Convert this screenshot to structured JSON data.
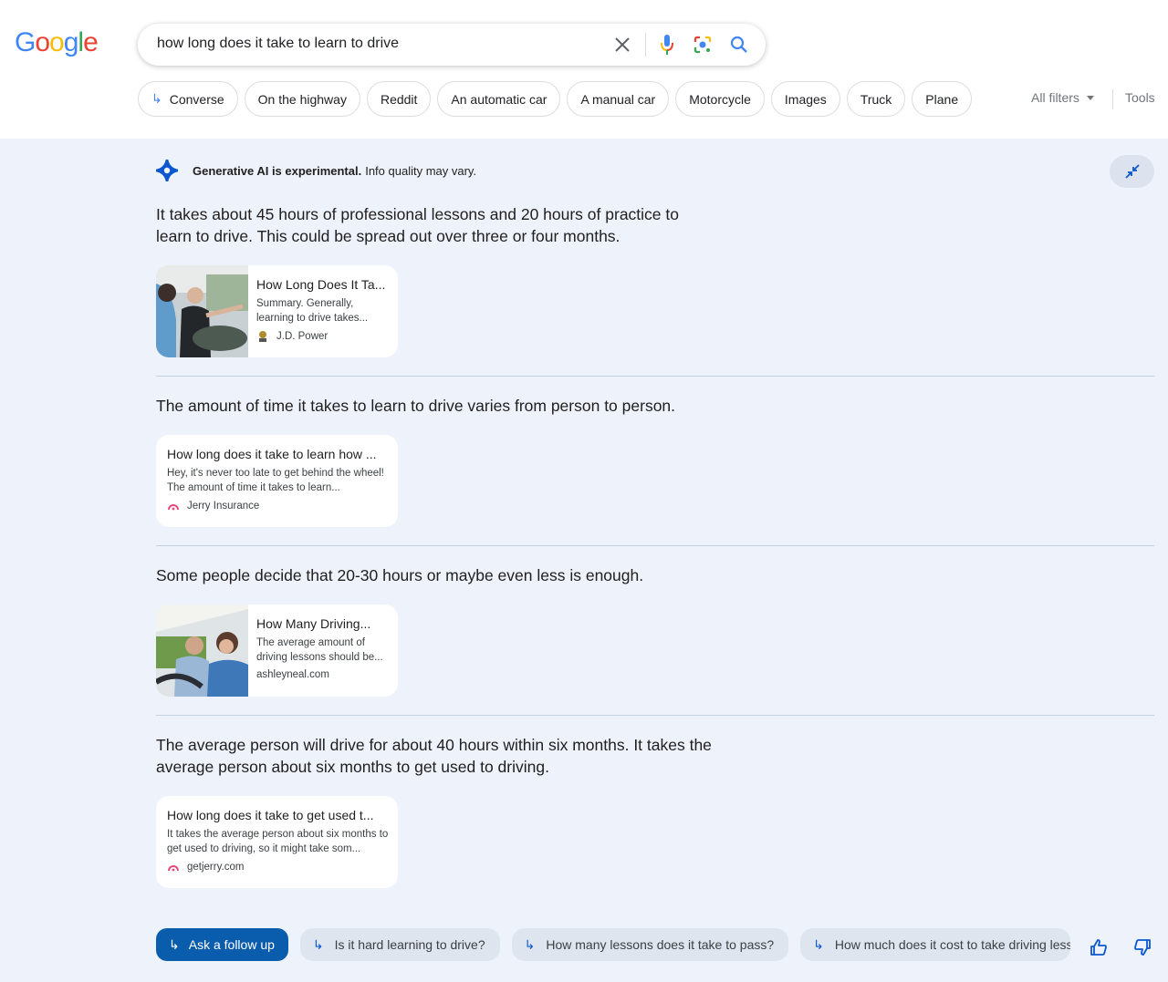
{
  "header": {
    "logo": {
      "letters": [
        "G",
        "o",
        "o",
        "g",
        "l",
        "e"
      ],
      "colors": [
        "#4285f4",
        "#ea4335",
        "#fbbc05",
        "#4285f4",
        "#34a853",
        "#ea4335"
      ]
    },
    "search": {
      "query": "how long does it take to learn to drive"
    },
    "icons": {
      "clear": "close-icon",
      "voice": "microphone-icon",
      "lens": "lens-icon",
      "search": "search-icon"
    },
    "chips": [
      {
        "label": "Converse",
        "icon": "follow-up-arrow-icon"
      },
      {
        "label": "On the highway"
      },
      {
        "label": "Reddit"
      },
      {
        "label": "An automatic car"
      },
      {
        "label": "A manual car"
      },
      {
        "label": "Motorcycle"
      },
      {
        "label": "Images"
      },
      {
        "label": "Truck"
      },
      {
        "label": "Plane"
      }
    ],
    "all_filters": "All filters",
    "tools": "Tools"
  },
  "sge": {
    "banner_bold": "Generative AI is experimental.",
    "banner_rest": "Info quality may vary.",
    "accent": "#0b57d0",
    "sections": [
      {
        "text": "It takes about 45 hours of professional lessons and 20 hours of practice to learn to drive. This could be spread out over three or four months.",
        "card": {
          "title": "How Long Does It Ta...",
          "snippet": "Summary. Generally, learning to drive takes...",
          "source": "J.D. Power",
          "has_image": true
        }
      },
      {
        "text": "The amount of time it takes to learn to drive varies from person to person.",
        "card": {
          "title": "How long does it take to learn how ...",
          "snippet": "Hey, it's never too late to get behind the wheel! The amount of time it takes to learn...",
          "source": "Jerry Insurance",
          "has_image": false
        }
      },
      {
        "text": "Some people decide that 20-30 hours or maybe even less is enough.",
        "card": {
          "title": "How Many Driving...",
          "snippet": "The average amount of driving lessons should be...",
          "source": "ashleyneal.com",
          "has_image": true
        }
      },
      {
        "text": "The average person will drive for about 40 hours within six months. It takes the average person about six months to get used to driving.",
        "card": {
          "title": "How long does it take to get used t...",
          "snippet": "It takes the average person about six months to get used to driving, so it might take som...",
          "source": "getjerry.com",
          "has_image": false
        }
      }
    ],
    "follow_up": {
      "ask_label": "Ask a follow up",
      "suggestions": [
        "Is it hard learning to drive?",
        "How many lessons does it take to pass?",
        "How much does it cost to take driving lessons?"
      ]
    }
  }
}
